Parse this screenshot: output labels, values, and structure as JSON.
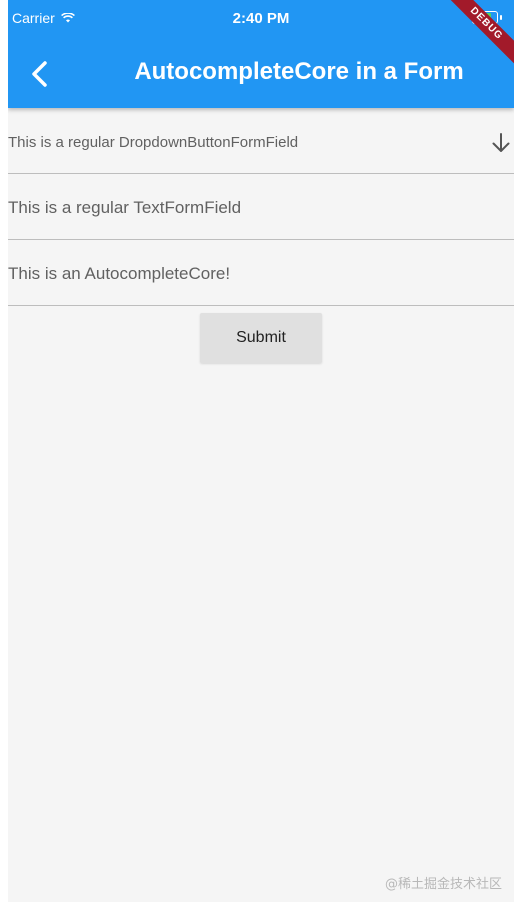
{
  "status_bar": {
    "carrier": "Carrier",
    "time": "2:40 PM",
    "battery_color": "#4cd964"
  },
  "app_bar": {
    "title": "AutocompleteCore in a Form",
    "back_icon": "chevron-left-icon",
    "color": "#2196f3",
    "debug_banner": "DEBUG"
  },
  "form": {
    "dropdown_label": "This is a regular DropdownButtonFormField",
    "dropdown_icon": "arrow-down-icon",
    "text_field_label": "This is a regular TextFormField",
    "autocomplete_label": "This is an AutocompleteCore!",
    "submit_label": "Submit"
  },
  "watermark": "@稀土掘金技术社区"
}
